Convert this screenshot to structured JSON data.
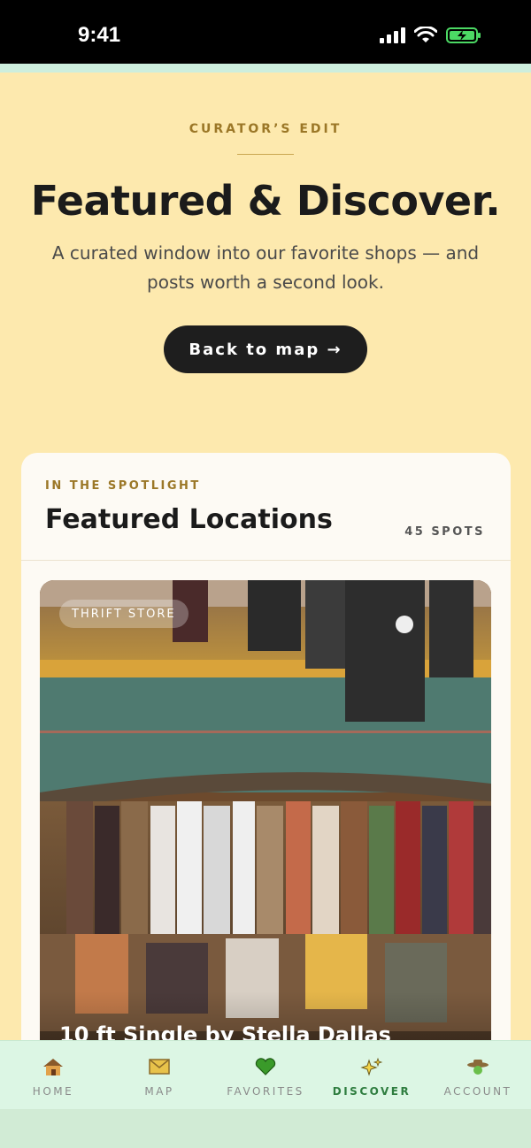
{
  "status_bar": {
    "time": "9:41"
  },
  "hero": {
    "eyebrow": "CURATOR’S EDIT",
    "title": "Featured & Discover.",
    "subtitle": "A curated window into our favorite shops — and posts worth a second look.",
    "back_button_label": "Back to map →"
  },
  "featured": {
    "eyebrow": "IN THE SPOTLIGHT",
    "title": "Featured Locations",
    "count_label": "45 SPOTS",
    "card": {
      "category": "THRIFT STORE",
      "name": "10 ft Single by Stella Dallas"
    }
  },
  "nav": {
    "items": [
      {
        "label": "HOME",
        "icon": "house-icon"
      },
      {
        "label": "MAP",
        "icon": "map-icon"
      },
      {
        "label": "FAVORITES",
        "icon": "heart-icon"
      },
      {
        "label": "DISCOVER",
        "icon": "sparkles-icon",
        "active": true
      },
      {
        "label": "ACCOUNT",
        "icon": "cowboy-hat-icon"
      }
    ]
  },
  "colors": {
    "hero_bg": "#fde9ae",
    "accent_gold": "#9b7727",
    "nav_bg": "#dcf6e4",
    "active_nav": "#2e7d3f",
    "button_bg": "#1e1e1e"
  }
}
